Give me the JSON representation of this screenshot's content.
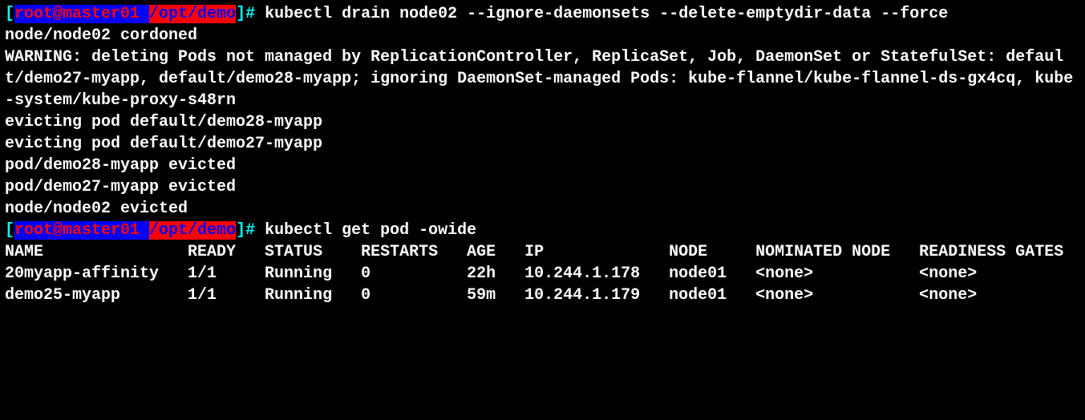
{
  "prompt": {
    "bracket_open": "[",
    "bracket_close": "]",
    "user": "root@master01 ",
    "path": "/opt/demo",
    "hash": "#",
    "space": " "
  },
  "commands": {
    "cmd1": "kubectl drain node02 --ignore-daemonsets --delete-emptydir-data --force",
    "cmd2": "kubectl get pod -owide"
  },
  "output1": {
    "l1": "node/node02 cordoned",
    "l2": "WARNING: deleting Pods not managed by ReplicationController, ReplicaSet, Job, DaemonSet or StatefulSet: default/demo27-myapp, default/demo28-myapp; ignoring DaemonSet-managed Pods: kube-flannel/kube-flannel-ds-gx4cq, kube-system/kube-proxy-s48rn",
    "l3": "evicting pod default/demo28-myapp",
    "l4": "evicting pod default/demo27-myapp",
    "l5": "pod/demo28-myapp evicted",
    "l6": "pod/demo27-myapp evicted",
    "l7": "node/node02 evicted"
  },
  "table": {
    "header": "NAME               READY   STATUS    RESTARTS   AGE   IP             NODE     NOMINATED NODE   READINESS GATES",
    "row1": "20myapp-affinity   1/1     Running   0          22h   10.244.1.178   node01   <none>           <none>",
    "row2": "demo25-myapp       1/1     Running   0          59m   10.244.1.179   node01   <none>           <none>"
  }
}
